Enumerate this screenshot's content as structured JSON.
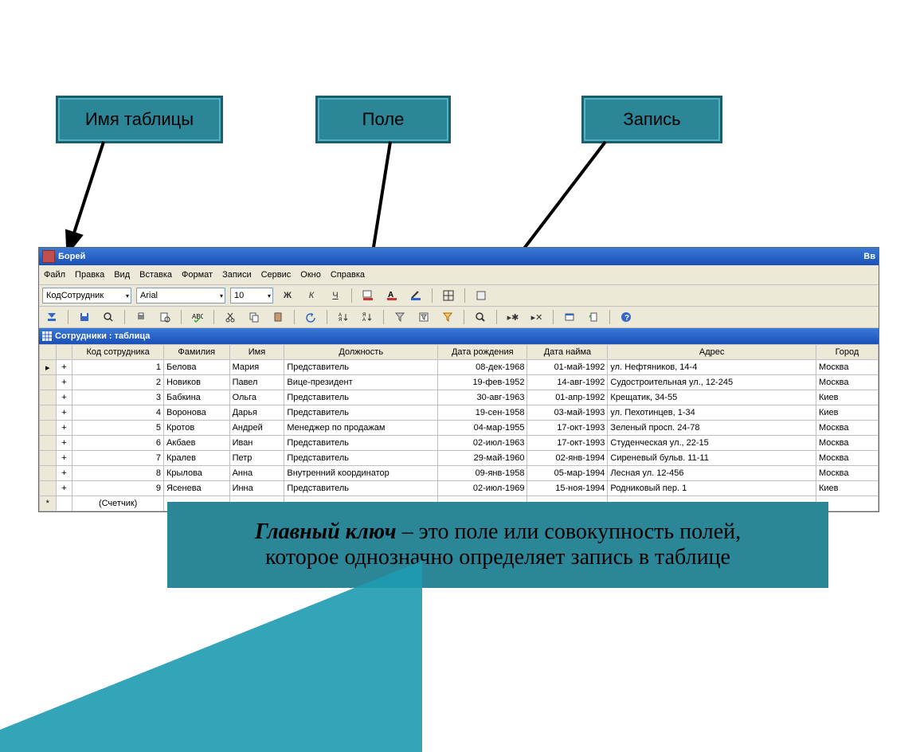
{
  "callouts": {
    "table_name": "Имя таблицы",
    "field": "Поле",
    "record": "Запись"
  },
  "window": {
    "title": "Борей",
    "right_fragment": "Вв",
    "menu": [
      "Файл",
      "Правка",
      "Вид",
      "Вставка",
      "Формат",
      "Записи",
      "Сервис",
      "Окно",
      "Справка"
    ],
    "font_field_label": "КодСотрудник",
    "font_name": "Arial",
    "font_size": "10",
    "bold": "Ж",
    "italic": "К",
    "underline": "Ч"
  },
  "subwindow": {
    "title": "Сотрудники : таблица"
  },
  "columns": [
    "Код сотрудника",
    "Фамилия",
    "Имя",
    "Должность",
    "Дата рождения",
    "Дата найма",
    "Адрес",
    "Город"
  ],
  "rows": [
    {
      "id": "1",
      "ln": "Белова",
      "fn": "Мария",
      "pos": "Представитель",
      "bd": "08-дек-1968",
      "hd": "01-май-1992",
      "addr": "ул. Нефтяников, 14-4",
      "city": "Москва"
    },
    {
      "id": "2",
      "ln": "Новиков",
      "fn": "Павел",
      "pos": "Вице-президент",
      "bd": "19-фев-1952",
      "hd": "14-авг-1992",
      "addr": "Судостроительная ул., 12-245",
      "city": "Москва"
    },
    {
      "id": "3",
      "ln": "Бабкина",
      "fn": "Ольга",
      "pos": "Представитель",
      "bd": "30-авг-1963",
      "hd": "01-апр-1992",
      "addr": "Крещатик, 34-55",
      "city": "Киев"
    },
    {
      "id": "4",
      "ln": "Воронова",
      "fn": "Дарья",
      "pos": "Представитель",
      "bd": "19-сен-1958",
      "hd": "03-май-1993",
      "addr": "ул. Пехотинцев, 1-34",
      "city": "Киев"
    },
    {
      "id": "5",
      "ln": "Кротов",
      "fn": "Андрей",
      "pos": "Менеджер по продажам",
      "bd": "04-мар-1955",
      "hd": "17-окт-1993",
      "addr": "Зеленый просп. 24-78",
      "city": "Москва"
    },
    {
      "id": "6",
      "ln": "Акбаев",
      "fn": "Иван",
      "pos": "Представитель",
      "bd": "02-июл-1963",
      "hd": "17-окт-1993",
      "addr": "Студенческая ул., 22-15",
      "city": "Москва"
    },
    {
      "id": "7",
      "ln": "Кралев",
      "fn": "Петр",
      "pos": "Представитель",
      "bd": "29-май-1960",
      "hd": "02-янв-1994",
      "addr": "Сиреневый бульв. 11-11",
      "city": "Москва"
    },
    {
      "id": "8",
      "ln": "Крылова",
      "fn": "Анна",
      "pos": "Внутренний координатор",
      "bd": "09-янв-1958",
      "hd": "05-мар-1994",
      "addr": "Лесная ул. 12-456",
      "city": "Москва"
    },
    {
      "id": "9",
      "ln": "Ясенева",
      "fn": "Инна",
      "pos": "Представитель",
      "bd": "02-июл-1969",
      "hd": "15-ноя-1994",
      "addr": "Родниковый пер. 1",
      "city": "Киев"
    }
  ],
  "new_row_label": "(Счетчик)",
  "footer": {
    "keyterm": "Главный ключ",
    "rest1": " – это поле или совокупность полей,",
    "line2": "которое однозначно определяет запись в таблице"
  }
}
